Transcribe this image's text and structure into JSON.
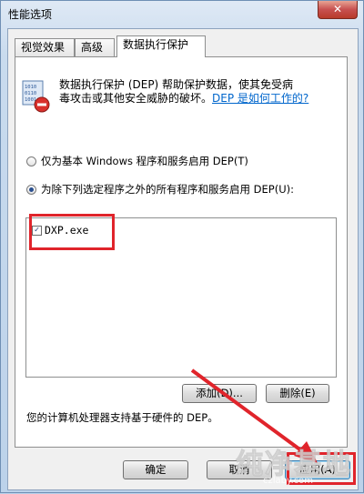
{
  "window": {
    "title": "性能选项",
    "close_glyph": "✕"
  },
  "tabs": [
    {
      "label": "视觉效果",
      "active": false
    },
    {
      "label": "高级",
      "active": false
    },
    {
      "label": "数据执行保护",
      "active": true
    }
  ],
  "dep": {
    "description": "数据执行保护 (DEP) 帮助防止病毒和其他安全威胁的破坏。",
    "description_line1": "数据执行保护 (DEP) 帮助保护数据，使其免受病",
    "description_line2": "毒攻击或其他安全威胁的破坏。",
    "link_text": "DEP 是如何工作的?",
    "radio_basic": "仅为基本 Windows 程序和服务启用 DEP(T)",
    "radio_all_except": "为除下列选定程序之外的所有程序和服务启用 DEP(U):",
    "selected_option": "radio_all_except",
    "programs": [
      {
        "name": "DXP.exe",
        "checked": true
      }
    ],
    "add_button": "添加(D)...",
    "remove_button": "删除(E)",
    "support_text": "您的计算机处理器支持基于硬件的 DEP。"
  },
  "footer": {
    "ok": "确定",
    "cancel": "取消",
    "apply": "应用(A)"
  },
  "watermark": {
    "cn": "纯净基地",
    "en": "czlaby.com"
  },
  "colors": {
    "highlight": "#e0242b",
    "link": "#0066cc"
  }
}
